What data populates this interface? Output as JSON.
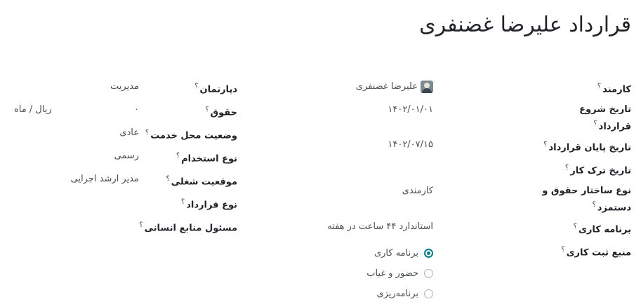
{
  "title": "قرارداد علیرضا غضنفری",
  "help_mark": "؟",
  "right": {
    "employee": {
      "label": "کارمند",
      "value": "علیرضا غضنفری"
    },
    "start_date": {
      "label": "تاریخ شروع قرارداد",
      "value": "۱۴۰۲/۰۱/۰۱"
    },
    "end_date": {
      "label": "تاریخ پایان قرارداد",
      "value": "۱۴۰۲/۰۷/۱۵"
    },
    "leave_date": {
      "label": "تاریخ ترک کار",
      "value": ""
    },
    "salary_structure": {
      "label": "نوع ساختار حقوق و دستمزد",
      "value": "کارمندی"
    },
    "work_schedule": {
      "label": "برنامه کاری",
      "value": "استاندارد ۴۴ ساعت در هفته"
    },
    "work_entry_source": {
      "label": "منبع ثبت کاری",
      "options": [
        {
          "label": "برنامه کاری",
          "selected": true
        },
        {
          "label": "حضور و غیاب",
          "selected": false
        },
        {
          "label": "برنامه‌ریزی",
          "selected": false
        }
      ]
    }
  },
  "left": {
    "department": {
      "label": "دپارتمان",
      "value": "مدیریت"
    },
    "wage": {
      "label": "حقوق",
      "amount": "۰",
      "unit": "ریال / ماه"
    },
    "work_location": {
      "label": "وضعیت محل خدمت",
      "value": "عادی"
    },
    "employment_type": {
      "label": "نوع استخدام",
      "value": "رسمی"
    },
    "job_position": {
      "label": "موقعیت شغلی",
      "value": "مدیر ارشد اجرایی"
    },
    "contract_type": {
      "label": "نوع قرارداد",
      "value": ""
    },
    "hr_responsible": {
      "label": "مسئول منابع انسانی",
      "value": ""
    }
  },
  "colors": {
    "accent": "#017e84",
    "text": "#212529",
    "muted": "#495057"
  }
}
